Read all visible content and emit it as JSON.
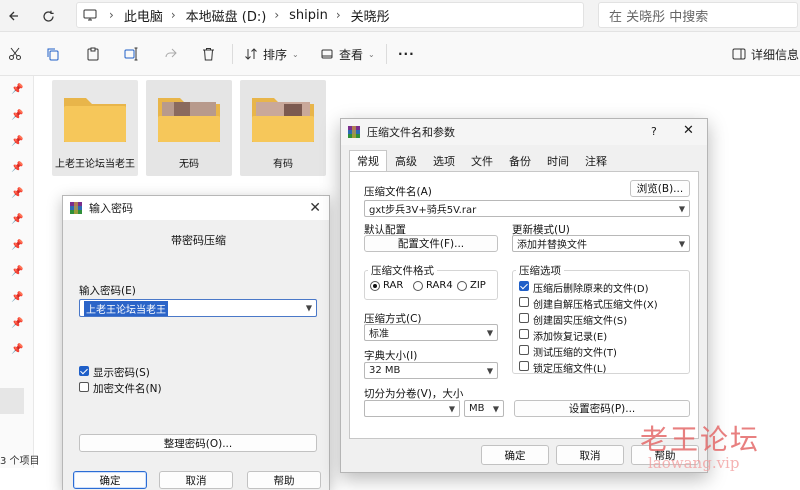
{
  "address": {
    "crumbs": [
      "此电脑",
      "本地磁盘 (D:)",
      "shipin",
      "关晓彤"
    ],
    "search_placeholder": "在 关晓彤 中搜索"
  },
  "toolbar": {
    "sort_label": "排序",
    "view_label": "查看",
    "more_label": "···",
    "details_label": "详细信息"
  },
  "folders": [
    {
      "name": "上老王论坛当老王"
    },
    {
      "name": "无码"
    },
    {
      "name": "有码"
    }
  ],
  "status": {
    "count_text": "3 个项目",
    "prefix": "3"
  },
  "password_dialog": {
    "title": "输入密码",
    "subtitle": "带密码压缩",
    "input_label": "输入密码(E)",
    "input_value": "上老王论坛当老王",
    "show_password": "显示密码(S)",
    "encrypt_names": "加密文件名(N)",
    "organize_button": "整理密码(O)...",
    "ok": "确定",
    "cancel": "取消",
    "help": "帮助"
  },
  "rar_dialog": {
    "title": "压缩文件名和参数",
    "help_btn": "?",
    "tabs": [
      "常规",
      "高级",
      "选项",
      "文件",
      "备份",
      "时间",
      "注释"
    ],
    "archive_name_label": "压缩文件名(A)",
    "browse_button": "浏览(B)...",
    "archive_name_value": "gxt步兵3V+骑兵5V.rar",
    "default_config_label": "默认配置",
    "profiles_button": "配置文件(F)...",
    "update_mode_label": "更新模式(U)",
    "update_mode_value": "添加并替换文件",
    "format_group": "压缩文件格式",
    "formats": [
      "RAR",
      "RAR4",
      "ZIP"
    ],
    "selected_format": "RAR",
    "options_group": "压缩选项",
    "options": [
      {
        "label": "压缩后删除原来的文件(D)",
        "checked": true
      },
      {
        "label": "创建自解压格式压缩文件(X)",
        "checked": false
      },
      {
        "label": "创建固实压缩文件(S)",
        "checked": false
      },
      {
        "label": "添加恢复记录(E)",
        "checked": false
      },
      {
        "label": "测试压缩的文件(T)",
        "checked": false
      },
      {
        "label": "锁定压缩文件(L)",
        "checked": false
      }
    ],
    "method_label": "压缩方式(C)",
    "method_value": "标准",
    "dict_label": "字典大小(I)",
    "dict_value": "32 MB",
    "split_label": "切分为分卷(V)，大小",
    "split_value": "",
    "split_unit": "MB",
    "set_password_button": "设置密码(P)...",
    "ok": "确定",
    "cancel": "取消",
    "help": "帮助"
  },
  "watermark": {
    "main": "老王论坛",
    "sub": "laowang.vip"
  },
  "colors": {
    "accent": "#1f5fc8",
    "folder": "#f6c75a",
    "watermark": "#e46a6a"
  }
}
